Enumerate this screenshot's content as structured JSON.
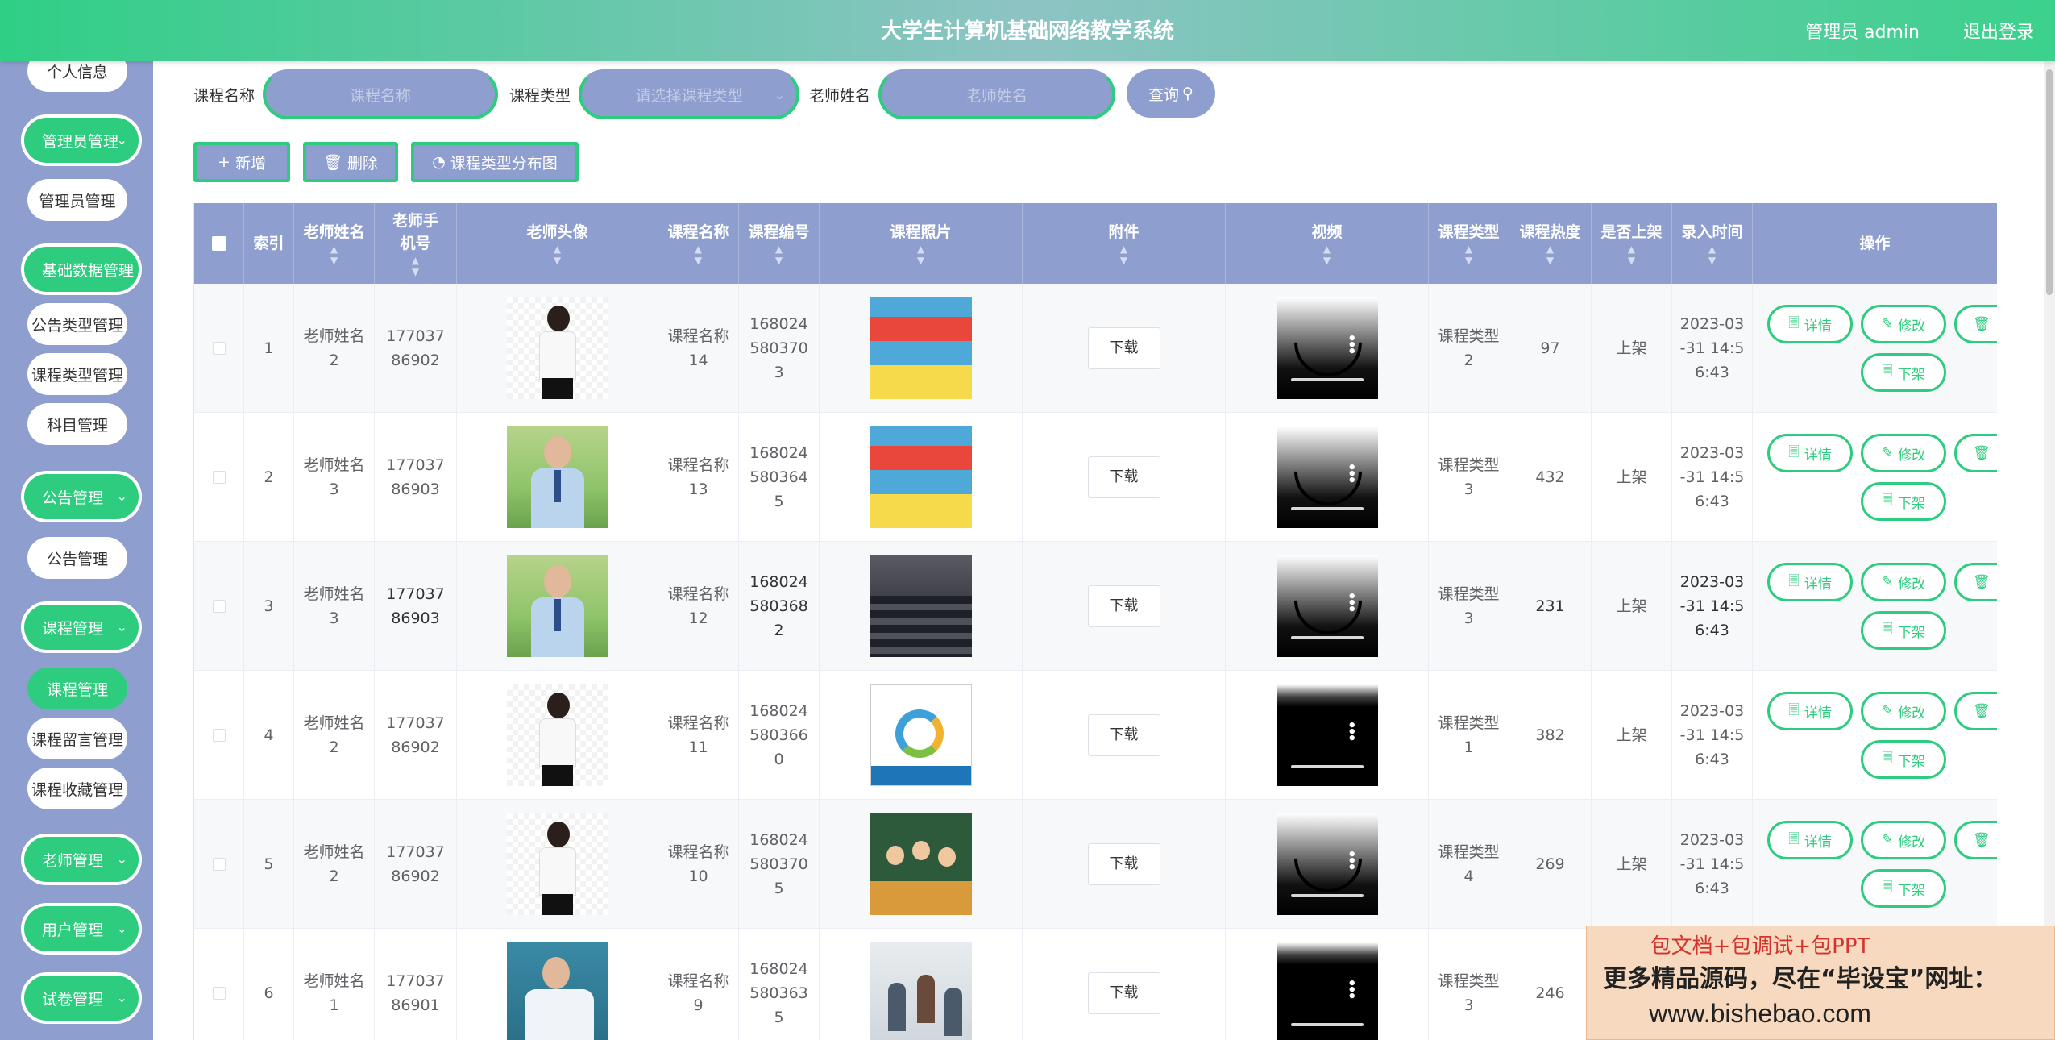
{
  "header": {
    "title": "大学生计算机基础网络教学系统",
    "user": "管理员 admin",
    "logout": "退出登录"
  },
  "sidebar": {
    "groups": [
      {
        "label": "个人信息",
        "type": "sub"
      },
      {
        "label": "管理员管理",
        "type": "group"
      },
      {
        "label": "管理员管理",
        "type": "sub"
      },
      {
        "label": "基础数据管理",
        "type": "group"
      },
      {
        "label": "公告类型管理",
        "type": "sub"
      },
      {
        "label": "课程类型管理",
        "type": "sub"
      },
      {
        "label": "科目管理",
        "type": "sub"
      },
      {
        "label": "公告管理",
        "type": "group"
      },
      {
        "label": "公告管理",
        "type": "sub"
      },
      {
        "label": "课程管理",
        "type": "group"
      },
      {
        "label": "课程管理",
        "type": "sub-active"
      },
      {
        "label": "课程留言管理",
        "type": "sub"
      },
      {
        "label": "课程收藏管理",
        "type": "sub"
      },
      {
        "label": "老师管理",
        "type": "group"
      },
      {
        "label": "用户管理",
        "type": "group"
      },
      {
        "label": "试卷管理",
        "type": "group"
      }
    ]
  },
  "search": {
    "course_name_label": "课程名称",
    "course_name_placeholder": "课程名称",
    "course_type_label": "课程类型",
    "course_type_placeholder": "请选择课程类型",
    "teacher_label": "老师姓名",
    "teacher_placeholder": "老师姓名",
    "query": "查询"
  },
  "actions": {
    "add": "新增",
    "delete": "删除",
    "chart": "课程类型分布图"
  },
  "table": {
    "headers": [
      "索引",
      "老师姓名",
      "老师手机号",
      "老师头像",
      "课程名称",
      "课程编号",
      "课程照片",
      "附件",
      "视频",
      "课程类型",
      "课程热度",
      "是否上架",
      "录入时间",
      "操作"
    ],
    "download": "下载",
    "ops": {
      "detail": "详情",
      "edit": "修改",
      "off": "下架"
    },
    "rows": [
      {
        "idx": "1",
        "teacher": "老师姓名2",
        "phone": "17703786902",
        "avatar": "woman",
        "course": "课程名称14",
        "code": "1680245803703",
        "photo": "book",
        "video": "gradient",
        "type": "课程类型2",
        "heat": "97",
        "status": "上架",
        "time": "2023-03-31 14:56:43"
      },
      {
        "idx": "2",
        "teacher": "老师姓名3",
        "phone": "17703786903",
        "avatar": "man",
        "course": "课程名称13",
        "code": "1680245803645",
        "photo": "book",
        "video": "gradient",
        "type": "课程类型3",
        "heat": "432",
        "status": "上架",
        "time": "2023-03-31 14:56:43"
      },
      {
        "idx": "3",
        "teacher": "老师姓名3",
        "phone": "17703786903",
        "avatar": "man",
        "course": "课程名称12",
        "code": "1680245803682",
        "photo": "class",
        "video": "gradient",
        "type": "课程类型3",
        "heat": "231",
        "status": "上架",
        "time": "2023-03-31 14:56:43"
      },
      {
        "idx": "4",
        "teacher": "老师姓名2",
        "phone": "17703786902",
        "avatar": "woman",
        "course": "课程名称11",
        "code": "1680245803660",
        "photo": "book2",
        "video": "black",
        "type": "课程类型1",
        "heat": "382",
        "status": "上架",
        "time": "2023-03-31 14:56:43"
      },
      {
        "idx": "5",
        "teacher": "老师姓名2",
        "phone": "17703786902",
        "avatar": "woman",
        "course": "课程名称10",
        "code": "1680245803705",
        "photo": "kids",
        "video": "gradient",
        "type": "课程类型4",
        "heat": "269",
        "status": "上架",
        "time": "2023-03-31 14:56:43"
      },
      {
        "idx": "6",
        "teacher": "老师姓名1",
        "phone": "17703786901",
        "avatar": "man2",
        "course": "课程名称9",
        "code": "1680245803635",
        "photo": "room",
        "video": "black",
        "type": "课程类型3",
        "heat": "246",
        "status": "",
        "time": ""
      }
    ]
  },
  "watermark": {
    "line1": "包文档+包调试+包PPT",
    "line2": "更多精品源码，尽在“毕设宝”网址：",
    "line3": "www.bishebao.com"
  },
  "colors": {
    "accent": "#2dcc7e",
    "header_bg": "#8e9fcf",
    "sidebar_bg": "#8e9fcf"
  }
}
